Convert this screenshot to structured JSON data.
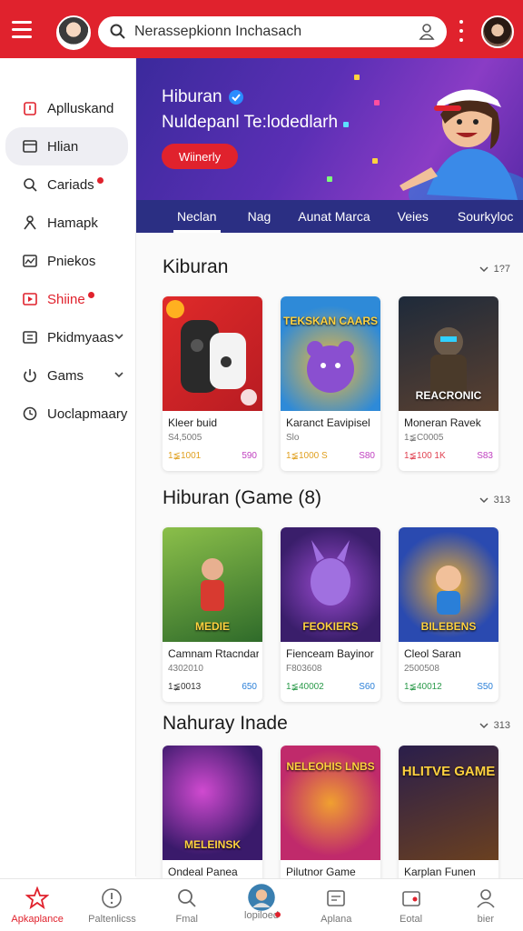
{
  "search": {
    "value": "Nerassepkionn Inchasach"
  },
  "sidebar": {
    "items": [
      {
        "label": "Aplluskand",
        "icon": "app-icon"
      },
      {
        "label": "Hlian",
        "icon": "window-icon"
      },
      {
        "label": "Cariads",
        "icon": "search-icon"
      },
      {
        "label": "Hamapk",
        "icon": "person-icon"
      },
      {
        "label": "Pniekos",
        "icon": "chart-icon"
      },
      {
        "label": "Shiine",
        "icon": "media-icon"
      },
      {
        "label": "Pkidmyaas",
        "icon": "gallery-icon"
      },
      {
        "label": "Gams",
        "icon": "power-icon"
      },
      {
        "label": "Uoclapmaary",
        "icon": "clock-icon"
      }
    ]
  },
  "banner": {
    "title": "Hiburan",
    "subtitle": "Nuldepanl Te:lodedlarh",
    "button": "Wiinerly"
  },
  "tabs": [
    "Neclan",
    "Nag",
    "Aunat Marca",
    "Veies",
    "Sourkyloc"
  ],
  "sections": [
    {
      "title": "Kiburan",
      "more": "1?7",
      "cards": [
        {
          "name": "Kleer buid",
          "sub": "S4,5005",
          "price": "1≨1001",
          "size": "590",
          "art_label": "",
          "colors": [
            "#d8242c",
            "#b81c22"
          ]
        },
        {
          "name": "Karanct Eavipisel",
          "sub": "Slo",
          "price": "1≨1000 S",
          "size": "S80",
          "art_label": "TEKSKAN CAARS",
          "colors": [
            "#2e8ad8",
            "#f3b93a"
          ]
        },
        {
          "name": "Moneran Ravek",
          "sub": "1≨C0005",
          "price": "1≨100 1K",
          "size": "S83",
          "art_label": "REACRONIC",
          "colors": [
            "#1e2a3a",
            "#5a4030"
          ]
        }
      ]
    },
    {
      "title": "Hiburan (Game (8)",
      "more": "313",
      "cards": [
        {
          "name": "Camnam Rtacndar",
          "sub": "4302010",
          "price": "1≨0013",
          "size": "650",
          "art_label": "MEDIE",
          "colors": [
            "#2f6b2a",
            "#8bbf4a"
          ]
        },
        {
          "name": "Fienceam Bayinor",
          "sub": "F803608",
          "price": "1≨40002",
          "size": "S60",
          "art_label": "FEOKIERS",
          "colors": [
            "#3a1e6b",
            "#9a4bd0"
          ]
        },
        {
          "name": "Cleol Saran",
          "sub": "2500508",
          "price": "1≨40012",
          "size": "S50",
          "art_label": "BILEBENS",
          "colors": [
            "#2a4ab0",
            "#f0b030"
          ]
        }
      ]
    },
    {
      "title": "Nahuray Inade",
      "more": "313",
      "cards": [
        {
          "name": "Ondeal Panea",
          "sub": "",
          "price": "",
          "size": "",
          "art_label": "MELEINSK",
          "colors": [
            "#3a1a6b",
            "#d04ad0"
          ]
        },
        {
          "name": "Pilutnor Game",
          "sub": "",
          "price": "",
          "size": "",
          "art_label": "NELEOHIS LNBS",
          "colors": [
            "#c02a6b",
            "#f0a030"
          ]
        },
        {
          "name": "Karplan Funen",
          "sub": "",
          "price": "",
          "size": "",
          "art_label": "HLITVE GAME",
          "colors": [
            "#2a1e4b",
            "#6a4020"
          ]
        }
      ]
    }
  ],
  "bottomnav": [
    {
      "label": "Apkaplance",
      "icon": "star-icon"
    },
    {
      "label": "Paltenlicss",
      "icon": "alert-icon"
    },
    {
      "label": "Fmal",
      "icon": "search-icon"
    },
    {
      "label": "lopiloed",
      "icon": "avatar-icon"
    },
    {
      "label": "Aplana",
      "icon": "window-icon"
    },
    {
      "label": "Eotal",
      "icon": "wallet-icon"
    },
    {
      "label": "bier",
      "icon": "person-icon"
    }
  ],
  "colors": {
    "brand_red": "#e0222d",
    "tab_bar": "#2b2f83",
    "banner_purple": "#5b2fb5"
  }
}
